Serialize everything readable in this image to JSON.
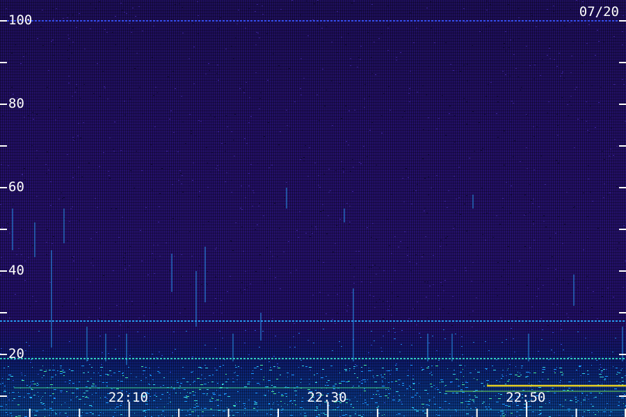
{
  "chart_data": {
    "type": "heatmap",
    "title": "",
    "xlabel": "",
    "ylabel": "",
    "date": "07/20",
    "y_ticks": [
      {
        "value": 100,
        "label": "100"
      },
      {
        "value": 80,
        "label": "80"
      },
      {
        "value": 60,
        "label": "60"
      },
      {
        "value": 40,
        "label": "40"
      },
      {
        "value": 20,
        "label": "20"
      }
    ],
    "y_minor_ticks": [
      90,
      70,
      50,
      30,
      10
    ],
    "ylim": [
      10,
      100
    ],
    "x_ticks": [
      {
        "value": "22:10",
        "label": "22:10"
      },
      {
        "value": "22:30",
        "label": "22:30"
      },
      {
        "value": "22:50",
        "label": "22:50"
      }
    ],
    "x_minor_ticks": [
      "22:00",
      "22:05",
      "22:15",
      "22:20",
      "22:25",
      "22:35",
      "22:40",
      "22:45",
      "22:55",
      "23:00"
    ],
    "xlim": [
      "21:57",
      "23:00"
    ],
    "horizontal_lines": [
      {
        "value": 100,
        "color": "#3a55ff"
      },
      {
        "value": 28,
        "color": "#2aa8ff"
      },
      {
        "value": 19,
        "color": "#36e0c8"
      }
    ],
    "colors": {
      "background": "#231068",
      "low_band": "#0c3c88",
      "signal": "#2ab8ff",
      "strong": "#e8d020",
      "axis": "#ffffff"
    }
  }
}
